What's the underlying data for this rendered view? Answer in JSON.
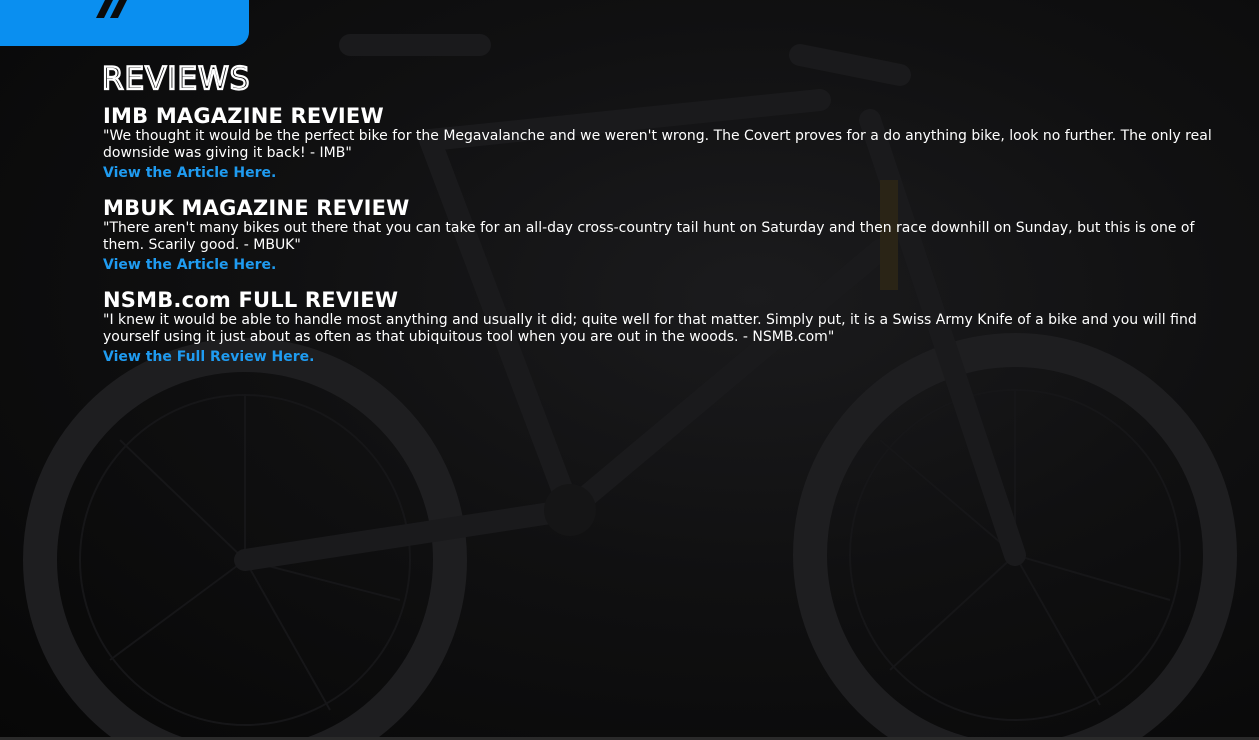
{
  "brand": {
    "accent_color": "#0a8ff0",
    "link_color": "#1f9bf0",
    "logo_icon": "brand-logo-icon"
  },
  "page": {
    "title": "REVIEWS"
  },
  "reviews": [
    {
      "heading": "IMB MAGAZINE REVIEW",
      "quote": "\"We thought it would be the perfect bike for the Megavalanche and we weren't wrong. The Covert proves for a do anything bike, look no further. The only real downside was giving it back! - IMB\"",
      "link_label": "View the Article Here."
    },
    {
      "heading": "MBUK MAGAZINE REVIEW",
      "quote": "\"There aren't many bikes out there that you can take for an all-day cross-country tail hunt on Saturday and then race downhill on Sunday, but this is one of them. Scarily good. - MBUK\"",
      "link_label": "View the Article Here."
    },
    {
      "heading": "NSMB.com FULL REVIEW",
      "quote": "\"I knew it would be able to handle most anything and usually it did; quite well for that matter. Simply put, it is a Swiss Army Knife of a bike and you will find yourself using it just about as often as that ubiquitous tool when you are out in the woods. - NSMB.com\"",
      "link_label": "View the Full Review Here."
    }
  ]
}
